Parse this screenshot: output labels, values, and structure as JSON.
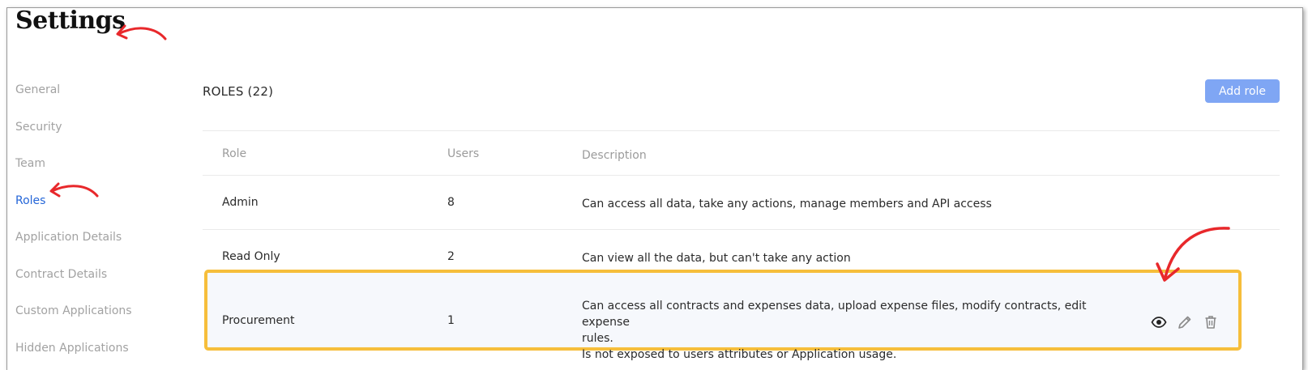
{
  "page": {
    "title": "Settings"
  },
  "sidebar": {
    "items": [
      {
        "label": "General",
        "active": false
      },
      {
        "label": "Security",
        "active": false
      },
      {
        "label": "Team",
        "active": false
      },
      {
        "label": "Roles",
        "active": true
      },
      {
        "label": "Application Details",
        "active": false
      },
      {
        "label": "Contract Details",
        "active": false
      },
      {
        "label": "Custom Applications",
        "active": false
      },
      {
        "label": "Hidden Applications",
        "active": false
      }
    ]
  },
  "roles": {
    "heading": "ROLES (22)",
    "add_button_label": "Add role",
    "columns": [
      "Role",
      "Users",
      "Description"
    ],
    "rows": [
      {
        "role": "Admin",
        "users": "8",
        "description": "Can access all data, take any actions, manage members and API access"
      },
      {
        "role": "Read Only",
        "users": "2",
        "description": "Can view all the data, but can't take any action"
      },
      {
        "role": "Procurement",
        "users": "1",
        "description_lines": [
          "Can access all contracts and expenses data, upload expense files, modify contracts, edit expense",
          "rules.",
          "Is not exposed to users attributes or Application usage."
        ]
      }
    ],
    "row_actions": [
      "eye-icon",
      "pencil-icon",
      "trash-icon"
    ]
  },
  "colors": {
    "accent": "#2566d8",
    "button": "#7fa6f4",
    "highlight_border": "#f6be3b",
    "annotation_arrow": "#e8282b"
  }
}
